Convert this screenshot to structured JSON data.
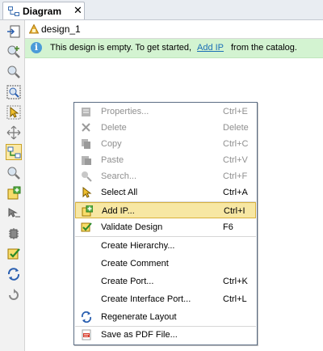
{
  "tab": {
    "label": "Diagram",
    "close": "✕"
  },
  "design": {
    "name": "design_1"
  },
  "banner": {
    "text_before": "This design is empty. To get started,",
    "link": "Add IP",
    "text_after": "from the catalog."
  },
  "menu": {
    "items": [
      {
        "label": "Properties...",
        "shortcut": "Ctrl+E",
        "enabled": false,
        "icon": "properties-icon"
      },
      {
        "label": "Delete",
        "shortcut": "Delete",
        "enabled": false,
        "icon": "delete-x-icon"
      },
      {
        "label": "Copy",
        "shortcut": "Ctrl+C",
        "enabled": false,
        "icon": "copy-icon"
      },
      {
        "label": "Paste",
        "shortcut": "Ctrl+V",
        "enabled": false,
        "icon": "paste-icon"
      },
      {
        "label": "Search...",
        "shortcut": "Ctrl+F",
        "enabled": false,
        "icon": "search-icon"
      },
      {
        "label": "Select All",
        "shortcut": "Ctrl+A",
        "enabled": true,
        "icon": "select-all-icon"
      },
      {
        "label": "Add IP...",
        "shortcut": "Ctrl+I",
        "enabled": true,
        "highlighted": true,
        "icon": "add-ip-icon"
      },
      {
        "label": "Validate Design",
        "shortcut": "F6",
        "enabled": true,
        "icon": "validate-icon"
      },
      {
        "label": "Create Hierarchy...",
        "shortcut": "",
        "enabled": true,
        "icon": ""
      },
      {
        "label": "Create Comment",
        "shortcut": "",
        "enabled": true,
        "icon": ""
      },
      {
        "label": "Create Port...",
        "shortcut": "Ctrl+K",
        "enabled": true,
        "icon": ""
      },
      {
        "label": "Create Interface Port...",
        "shortcut": "Ctrl+L",
        "enabled": true,
        "icon": ""
      },
      {
        "label": "Regenerate Layout",
        "shortcut": "",
        "enabled": true,
        "icon": "regenerate-icon"
      },
      {
        "label": "Save as PDF File...",
        "shortcut": "",
        "enabled": true,
        "icon": "pdf-icon"
      }
    ]
  },
  "toolbar": {
    "icons": [
      "fit-to-window-icon",
      "zoom-in-icon",
      "zoom-out-icon",
      "zoom-fit-icon",
      "select-icon",
      "move-icon",
      "auto-connect-icon",
      "search-icon",
      "add-ip-icon",
      "route-icon",
      "settings-icon",
      "validate-icon",
      "regenerate-icon",
      "reload-icon"
    ]
  },
  "colors": {
    "accent": "#f7e7a3",
    "banner": "#d3f3d1",
    "link": "#1b6fb6"
  }
}
